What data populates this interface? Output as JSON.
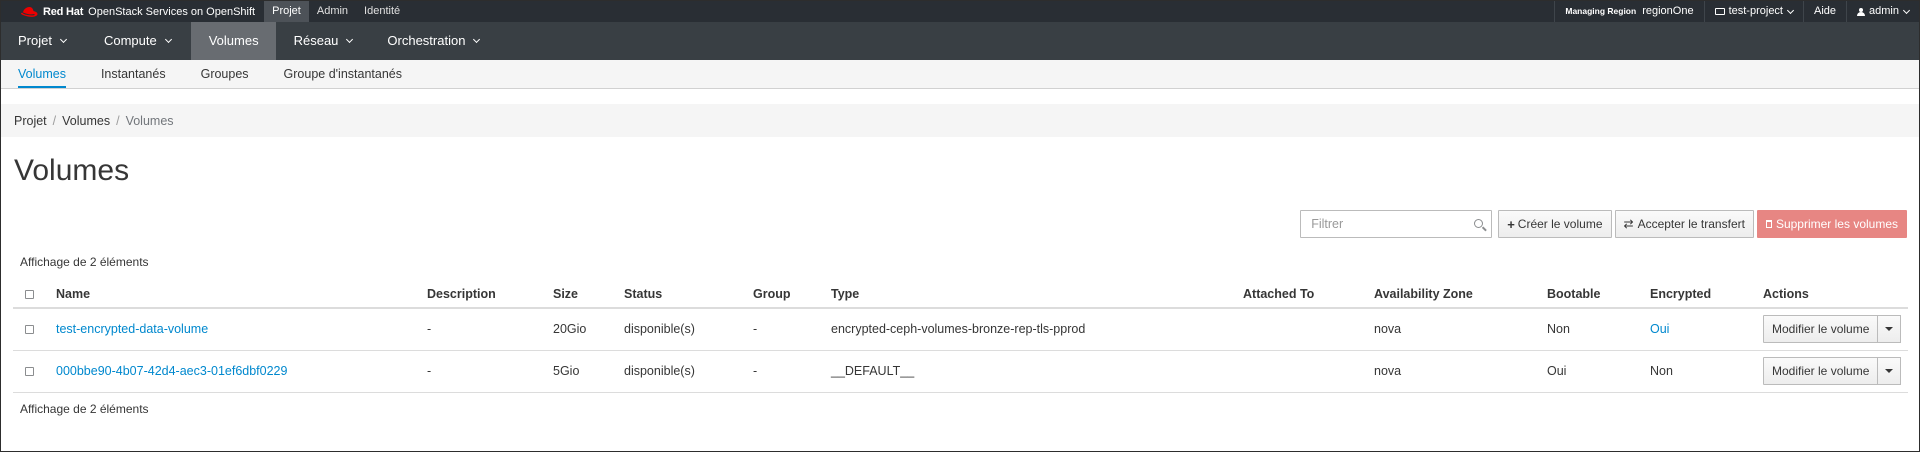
{
  "masthead": {
    "brand_redhat": "Red Hat",
    "brand_product": "OpenStack Services on OpenShift",
    "nav": [
      "Projet",
      "Admin",
      "Identité"
    ],
    "region_label": "Managing Region",
    "region_value": "regionOne",
    "project": "test-project",
    "help": "Aide",
    "user": "admin"
  },
  "primary_nav": [
    {
      "label": "Projet",
      "has_dropdown": true
    },
    {
      "label": "Compute",
      "has_dropdown": true
    },
    {
      "label": "Volumes",
      "has_dropdown": false,
      "active": true
    },
    {
      "label": "Réseau",
      "has_dropdown": true
    },
    {
      "label": "Orchestration",
      "has_dropdown": true
    }
  ],
  "secondary_nav": [
    "Volumes",
    "Instantanés",
    "Groupes",
    "Groupe d'instantanés"
  ],
  "breadcrumb": [
    "Projet",
    "Volumes",
    "Volumes"
  ],
  "page_title": "Volumes",
  "toolbar": {
    "filter_placeholder": "Filtrer",
    "create": "Créer le volume",
    "accept_transfer": "Accepter le transfert",
    "delete": "Supprimer les volumes"
  },
  "items_count_top": "Affichage de 2 éléments",
  "items_count_bottom": "Affichage de 2 éléments",
  "table": {
    "headers": [
      "Name",
      "Description",
      "Size",
      "Status",
      "Group",
      "Type",
      "Attached To",
      "Availability Zone",
      "Bootable",
      "Encrypted",
      "Actions"
    ],
    "rows": [
      {
        "name": "test-encrypted-data-volume",
        "description": "-",
        "size": "20Gio",
        "status": "disponible(s)",
        "group": "-",
        "type": "encrypted-ceph-volumes-bronze-rep-tls-pprod",
        "attached": "",
        "zone": "nova",
        "bootable": "Non",
        "encrypted": "Oui",
        "action": "Modifier le volume"
      },
      {
        "name": "000bbe90-4b07-42d4-aec3-01ef6dbf0229",
        "description": "-",
        "size": "5Gio",
        "status": "disponible(s)",
        "group": "-",
        "type": "__DEFAULT__",
        "attached": "",
        "zone": "nova",
        "bootable": "Oui",
        "encrypted": "Non",
        "action": "Modifier le volume"
      }
    ]
  },
  "colors": {
    "accent": "#0088ce",
    "masthead": "#292e34",
    "primary_nav": "#393f44",
    "primary_nav_active": "#686c71",
    "danger": "#e78683"
  }
}
